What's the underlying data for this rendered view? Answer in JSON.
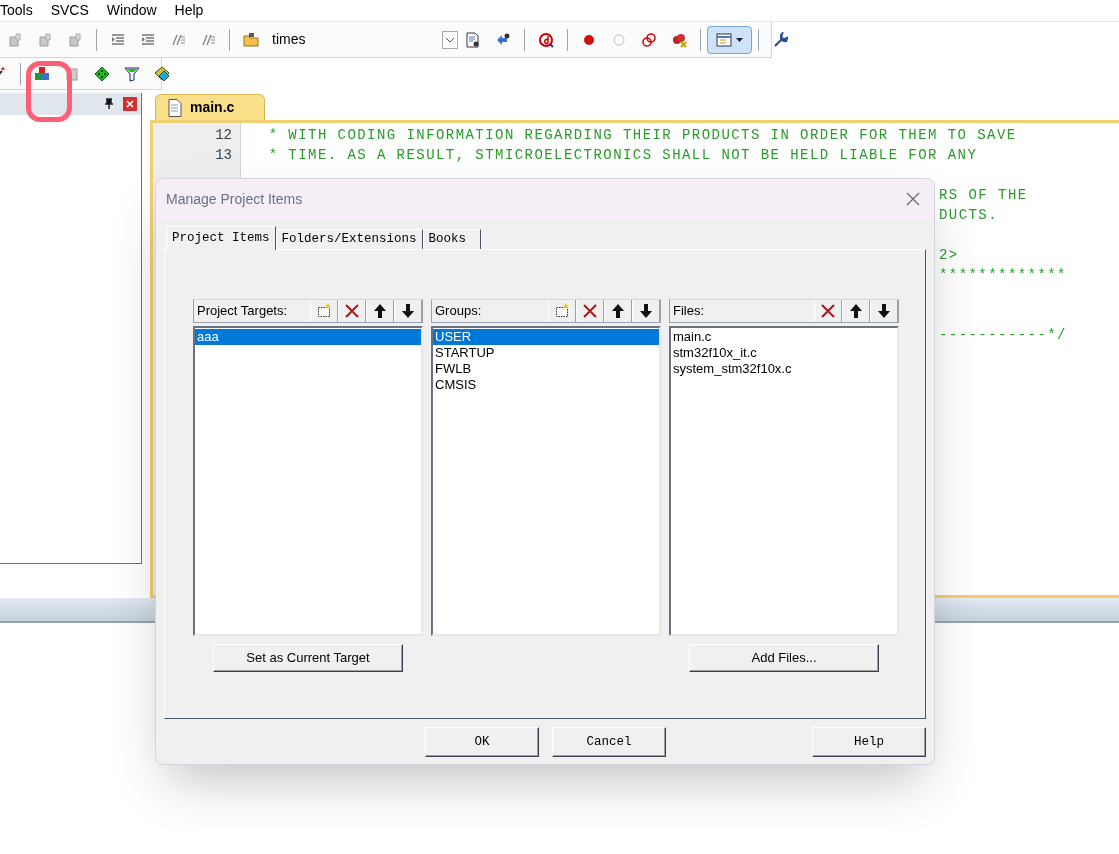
{
  "menu_bar": [
    "Tools",
    "SVCS",
    "Window",
    "Help"
  ],
  "toolbar": {
    "find_combo": {
      "value": "times"
    }
  },
  "editor": {
    "tabs": [
      {
        "label": "main.c",
        "selected": true
      }
    ],
    "lines": [
      {
        "kind": "line",
        "number": "12",
        "text": "  * WITH CODING INFORMATION REGARDING THEIR PRODUCTS IN ORDER FOR THEM TO SAVE"
      },
      {
        "kind": "line",
        "number": "13",
        "text": "  * TIME. AS A RESULT, STMICROELECTRONICS SHALL NOT BE HELD LIABLE FOR ANY"
      },
      {
        "kind": "blank"
      },
      {
        "kind": "fragment",
        "text": "RS OF THE"
      },
      {
        "kind": "fragment",
        "text": "DUCTS."
      },
      {
        "kind": "blank"
      },
      {
        "kind": "fragment",
        "text": "2>"
      },
      {
        "kind": "fragment",
        "text": "*************"
      },
      {
        "kind": "blank"
      },
      {
        "kind": "blank"
      },
      {
        "kind": "fragment",
        "text": "-----------*/"
      }
    ]
  },
  "dialog": {
    "title": "Manage Project Items",
    "tabs": [
      {
        "label": "Project Items",
        "selected": true
      },
      {
        "label": "Folders/Extensions",
        "selected": false
      },
      {
        "label": "Books",
        "selected": false
      }
    ],
    "lists": [
      {
        "label": "Project Targets:",
        "can_add": true,
        "items": [
          {
            "label": "aaa",
            "selected": true
          }
        ],
        "action": "Set as Current Target"
      },
      {
        "label": "Groups:",
        "can_add": true,
        "items": [
          {
            "label": "USER",
            "selected": true
          },
          {
            "label": "STARTUP",
            "selected": false
          },
          {
            "label": "FWLB",
            "selected": false
          },
          {
            "label": "CMSIS",
            "selected": false
          }
        ]
      },
      {
        "label": "Files:",
        "can_add": false,
        "items": [
          {
            "label": "main.c",
            "selected": false
          },
          {
            "label": "stm32f10x_it.c",
            "selected": false
          },
          {
            "label": "system_stm32f10x.c",
            "selected": false
          }
        ],
        "action": "Add Files..."
      }
    ],
    "buttons": [
      "OK",
      "Cancel",
      "Help"
    ]
  }
}
